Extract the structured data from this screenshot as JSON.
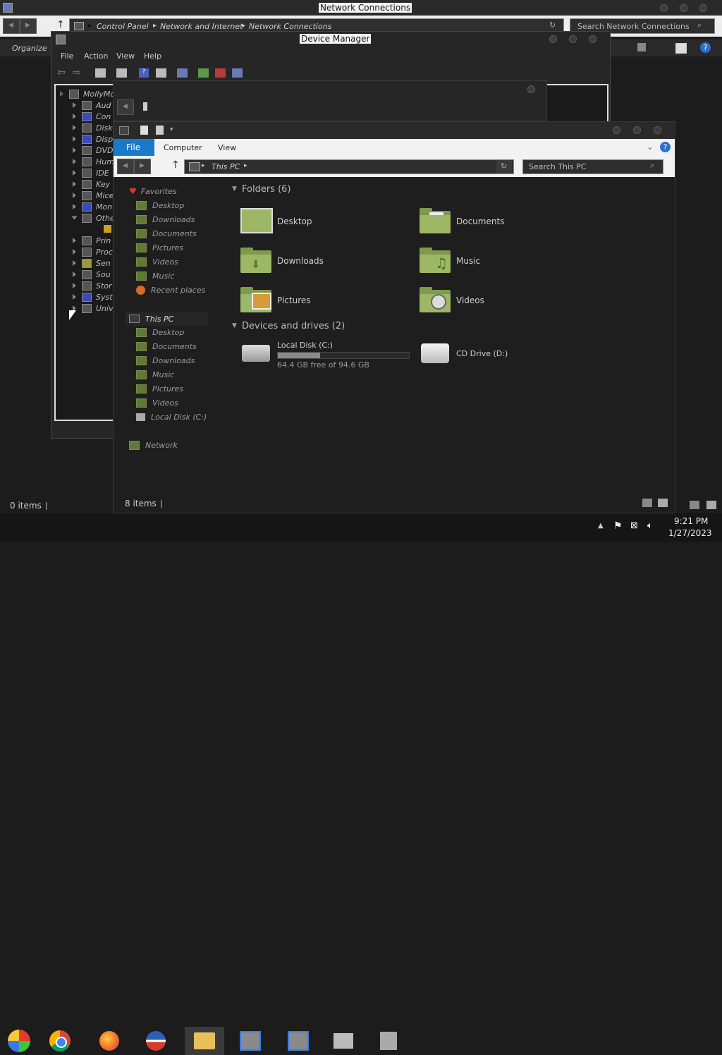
{
  "network_connections": {
    "title": "Network Connections",
    "breadcrumb": [
      "Control Panel",
      "Network and Internet",
      "Network Connections"
    ],
    "search_placeholder": "Search Network Connections",
    "organize": "Organize",
    "status": "0 items"
  },
  "device_manager": {
    "title": "Device Manager",
    "menu": [
      "File",
      "Action",
      "View",
      "Help"
    ],
    "root": "MollyMo",
    "items": [
      "Aud",
      "Con",
      "Disk",
      "Disp",
      "DVD",
      "Hum",
      "IDE",
      "Key",
      "Mice",
      "Mon",
      "Othe",
      "Prin",
      "Proc",
      "Sen",
      "Sou",
      "Stor",
      "Syst",
      "Univ"
    ]
  },
  "explorer": {
    "ribbon_tabs": [
      "File",
      "Computer",
      "View"
    ],
    "address": "This PC",
    "search_placeholder": "Search This PC",
    "sidebar": {
      "favorites_label": "Favorites",
      "favorites": [
        "Desktop",
        "Downloads",
        "Documents",
        "Pictures",
        "Videos",
        "Music",
        "Recent places"
      ],
      "this_pc_label": "This PC",
      "this_pc": [
        "Desktop",
        "Documents",
        "Downloads",
        "Music",
        "Pictures",
        "Videos",
        "Local Disk (C:)"
      ],
      "network_label": "Network"
    },
    "folders_header": "Folders (6)",
    "folders": [
      "Desktop",
      "Documents",
      "Downloads",
      "Music",
      "Pictures",
      "Videos"
    ],
    "drives_header": "Devices and drives (2)",
    "drive_c": {
      "name": "Local Disk (C:)",
      "free": "64.4 GB free of 94.6 GB",
      "used_fraction": 0.32
    },
    "drive_d": {
      "name": "CD Drive (D:)"
    },
    "status": "8 items"
  },
  "taskbar": {
    "time": "9:21 PM",
    "date": "1/27/2023"
  }
}
